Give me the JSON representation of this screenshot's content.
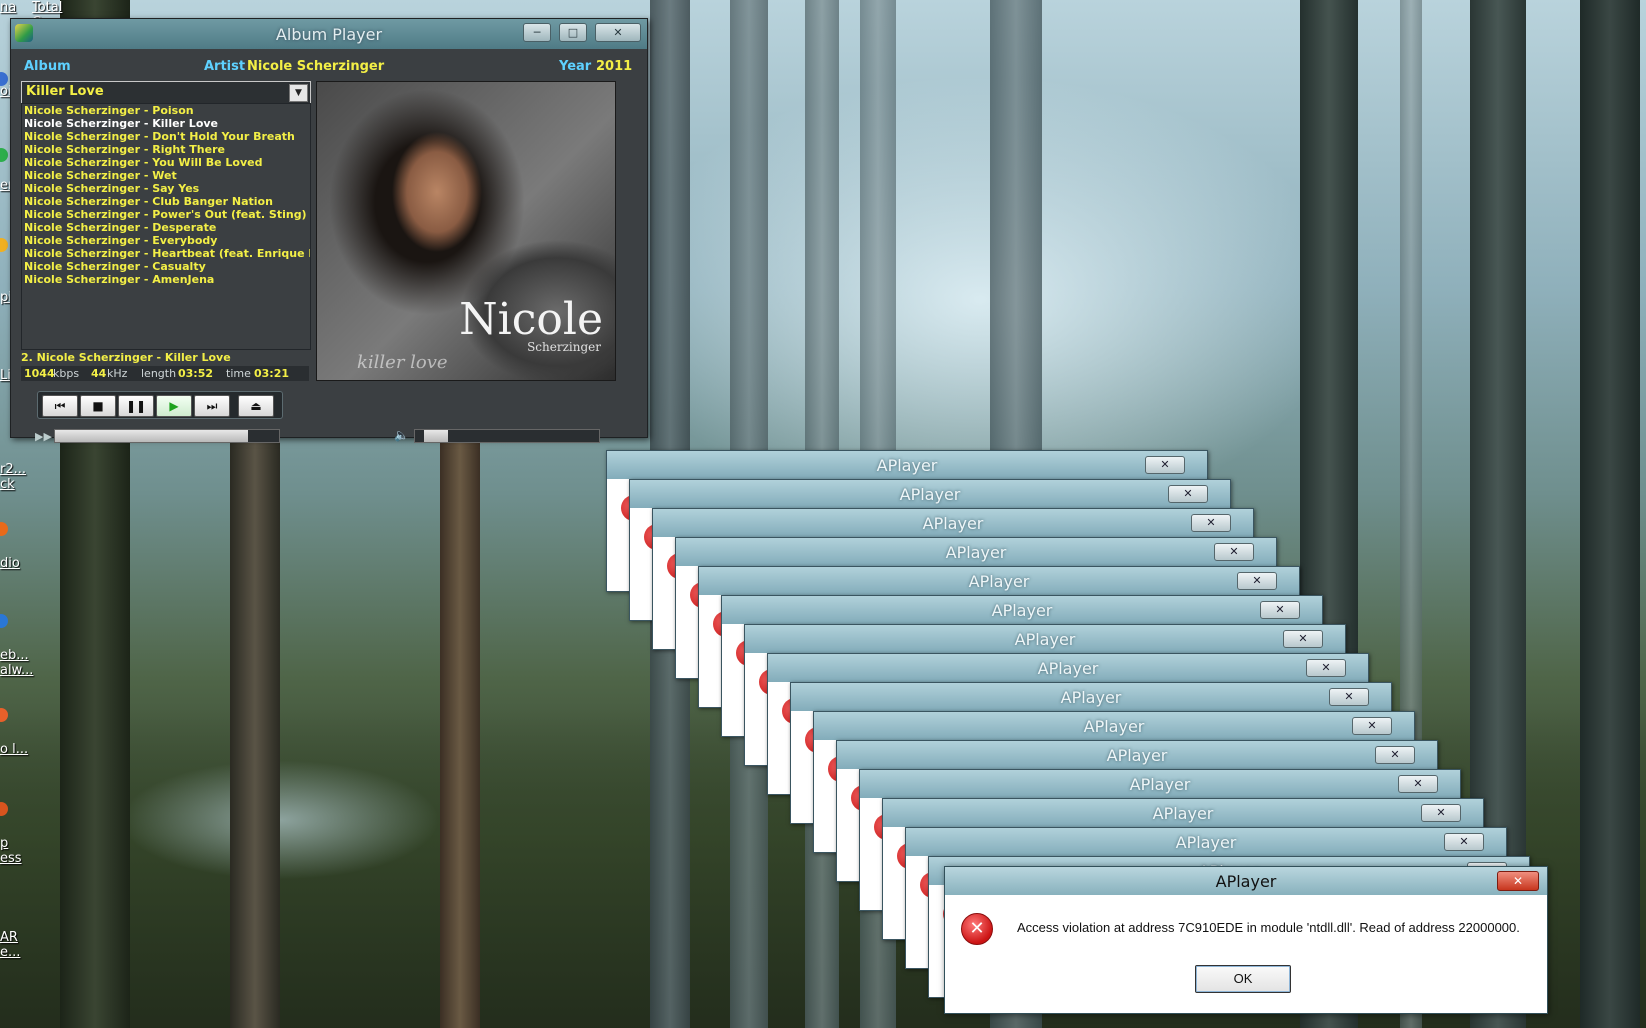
{
  "desktop": {
    "icons": [
      {
        "label": "na",
        "label2": "Total Comman"
      },
      {
        "label": "oi"
      },
      {
        "label": "er"
      },
      {
        "label": "pi"
      },
      {
        "label": "Li D"
      },
      {
        "label": "r2... ck"
      },
      {
        "label": "dio"
      },
      {
        "label": "eb... alw..."
      },
      {
        "label": "o l..."
      },
      {
        "label": "p ess"
      },
      {
        "label": "AR e..."
      }
    ]
  },
  "album_player": {
    "title": "Album Player",
    "album_label": "Album",
    "artist_label": "Artist",
    "artist": "Nicole Scherzinger",
    "year_label": "Year",
    "year": "2011",
    "selected_album": "Killer Love",
    "playlist": [
      "Nicole Scherzinger - Poison",
      "Nicole Scherzinger - Killer Love",
      "Nicole Scherzinger - Don't Hold Your Breath",
      "Nicole Scherzinger - Right There",
      "Nicole Scherzinger - You Will Be Loved",
      "Nicole Scherzinger - Wet",
      "Nicole Scherzinger - Say Yes",
      "Nicole Scherzinger - Club Banger Nation",
      "Nicole Scherzinger - Power's Out (feat. Sting)",
      "Nicole Scherzinger - Desperate",
      "Nicole Scherzinger - Everybody",
      "Nicole Scherzinger - Heartbeat (feat. Enrique Iglesias)",
      "Nicole Scherzinger - Casualty",
      "Nicole Scherzinger - AmenJena"
    ],
    "current_index": 1,
    "now_playing": "2.  Nicole Scherzinger - Killer Love",
    "bitrate": "1044",
    "bitrate_unit": "kbps",
    "samplerate": "44",
    "samplerate_unit": "kHz",
    "length_label": "length",
    "length": "03:52",
    "time_label": "time",
    "time": "03:21",
    "seek_fraction": 0.86,
    "volume_fraction": 0.05,
    "cover_name": "Nicole",
    "cover_sub": "Scherzinger",
    "cover_script": "killer love"
  },
  "aplayer_errors": {
    "title": "APlayer",
    "stack_count": 15,
    "message": "Access violation at address 7C910EDE in module 'ntdll.dll'. Read of address 22000000.",
    "ok_label": "OK"
  },
  "colors": {
    "label_cyan": "#5ed1ff",
    "label_yellow": "#f3ef46",
    "error_red": "#cc1414"
  }
}
